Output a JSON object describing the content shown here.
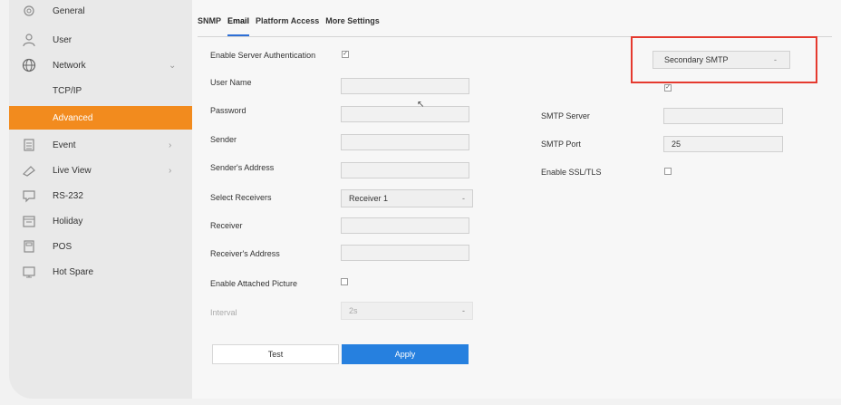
{
  "sidebar": {
    "items": [
      {
        "label": "General",
        "icon": "gear-icon"
      },
      {
        "label": "User",
        "icon": "user-icon"
      },
      {
        "label": "Network",
        "icon": "globe-icon",
        "expanded": true
      },
      {
        "label": "TCP/IP"
      },
      {
        "label": "Advanced",
        "active": true
      },
      {
        "label": "Event",
        "icon": "clipboard-icon"
      },
      {
        "label": "Live View",
        "icon": "camera-icon"
      },
      {
        "label": "RS-232",
        "icon": "chat-icon"
      },
      {
        "label": "Holiday",
        "icon": "calendar-icon"
      },
      {
        "label": "POS",
        "icon": "register-icon"
      },
      {
        "label": "Hot Spare",
        "icon": "monitor-icon"
      }
    ],
    "accent_color": "#f28b1e"
  },
  "tabs": [
    {
      "label": "SNMP",
      "active": false
    },
    {
      "label": "Email",
      "active": true
    },
    {
      "label": "Platform Access",
      "active": false
    },
    {
      "label": "More Settings",
      "active": false
    }
  ],
  "form": {
    "enable_auth_label": "Enable Server Authentication",
    "enable_auth_checked": true,
    "user_name_label": "User Name",
    "user_name_value": "",
    "password_label": "Password",
    "password_value": "",
    "sender_label": "Sender",
    "sender_value": "",
    "sender_address_label": "Sender's Address",
    "sender_address_value": "",
    "select_receivers_label": "Select Receivers",
    "select_receivers_value": "Receiver 1",
    "receiver_label": "Receiver",
    "receiver_value": "",
    "receiver_address_label": "Receiver's Address",
    "receiver_address_value": "",
    "attach_picture_label": "Enable Attached Picture",
    "attach_picture_checked": false,
    "interval_label": "Interval",
    "interval_value": "2s"
  },
  "right": {
    "smtp_select_value": "Secondary SMTP",
    "smtp_checkbox_checked": true,
    "smtp_server_label": "SMTP Server",
    "smtp_server_value": "",
    "smtp_port_label": "SMTP Port",
    "smtp_port_value": "25",
    "ssl_label": "Enable SSL/TLS",
    "ssl_checked": false,
    "highlight_color": "#e53a2f"
  },
  "buttons": {
    "test_label": "Test",
    "apply_label": "Apply",
    "apply_color": "#2680df"
  }
}
